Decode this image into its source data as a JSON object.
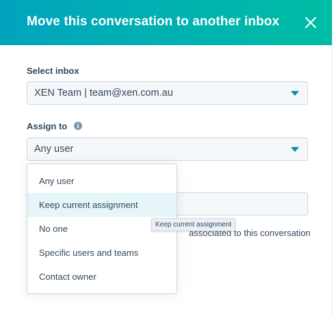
{
  "dialog": {
    "title": "Move this conversation to another inbox"
  },
  "select_inbox": {
    "label": "Select inbox",
    "value": "XEN Team | team@xen.com.au"
  },
  "assign_to": {
    "label": "Assign to",
    "value": "Any user"
  },
  "dropdown": {
    "options": [
      {
        "label": "Any user"
      },
      {
        "label": "Keep current assignment"
      },
      {
        "label": "No one"
      },
      {
        "label": "Specific users and teams"
      },
      {
        "label": "Contact owner"
      }
    ],
    "highlighted_index": 1
  },
  "tooltip": {
    "text": "Keep current assignment"
  },
  "hint": {
    "text": "associated to this conversation"
  },
  "colors": {
    "header_start": "#00a4bd",
    "header_end": "#00bda5",
    "caret": "#0091ae",
    "text": "#33475b",
    "highlight": "#e5f5f8"
  }
}
